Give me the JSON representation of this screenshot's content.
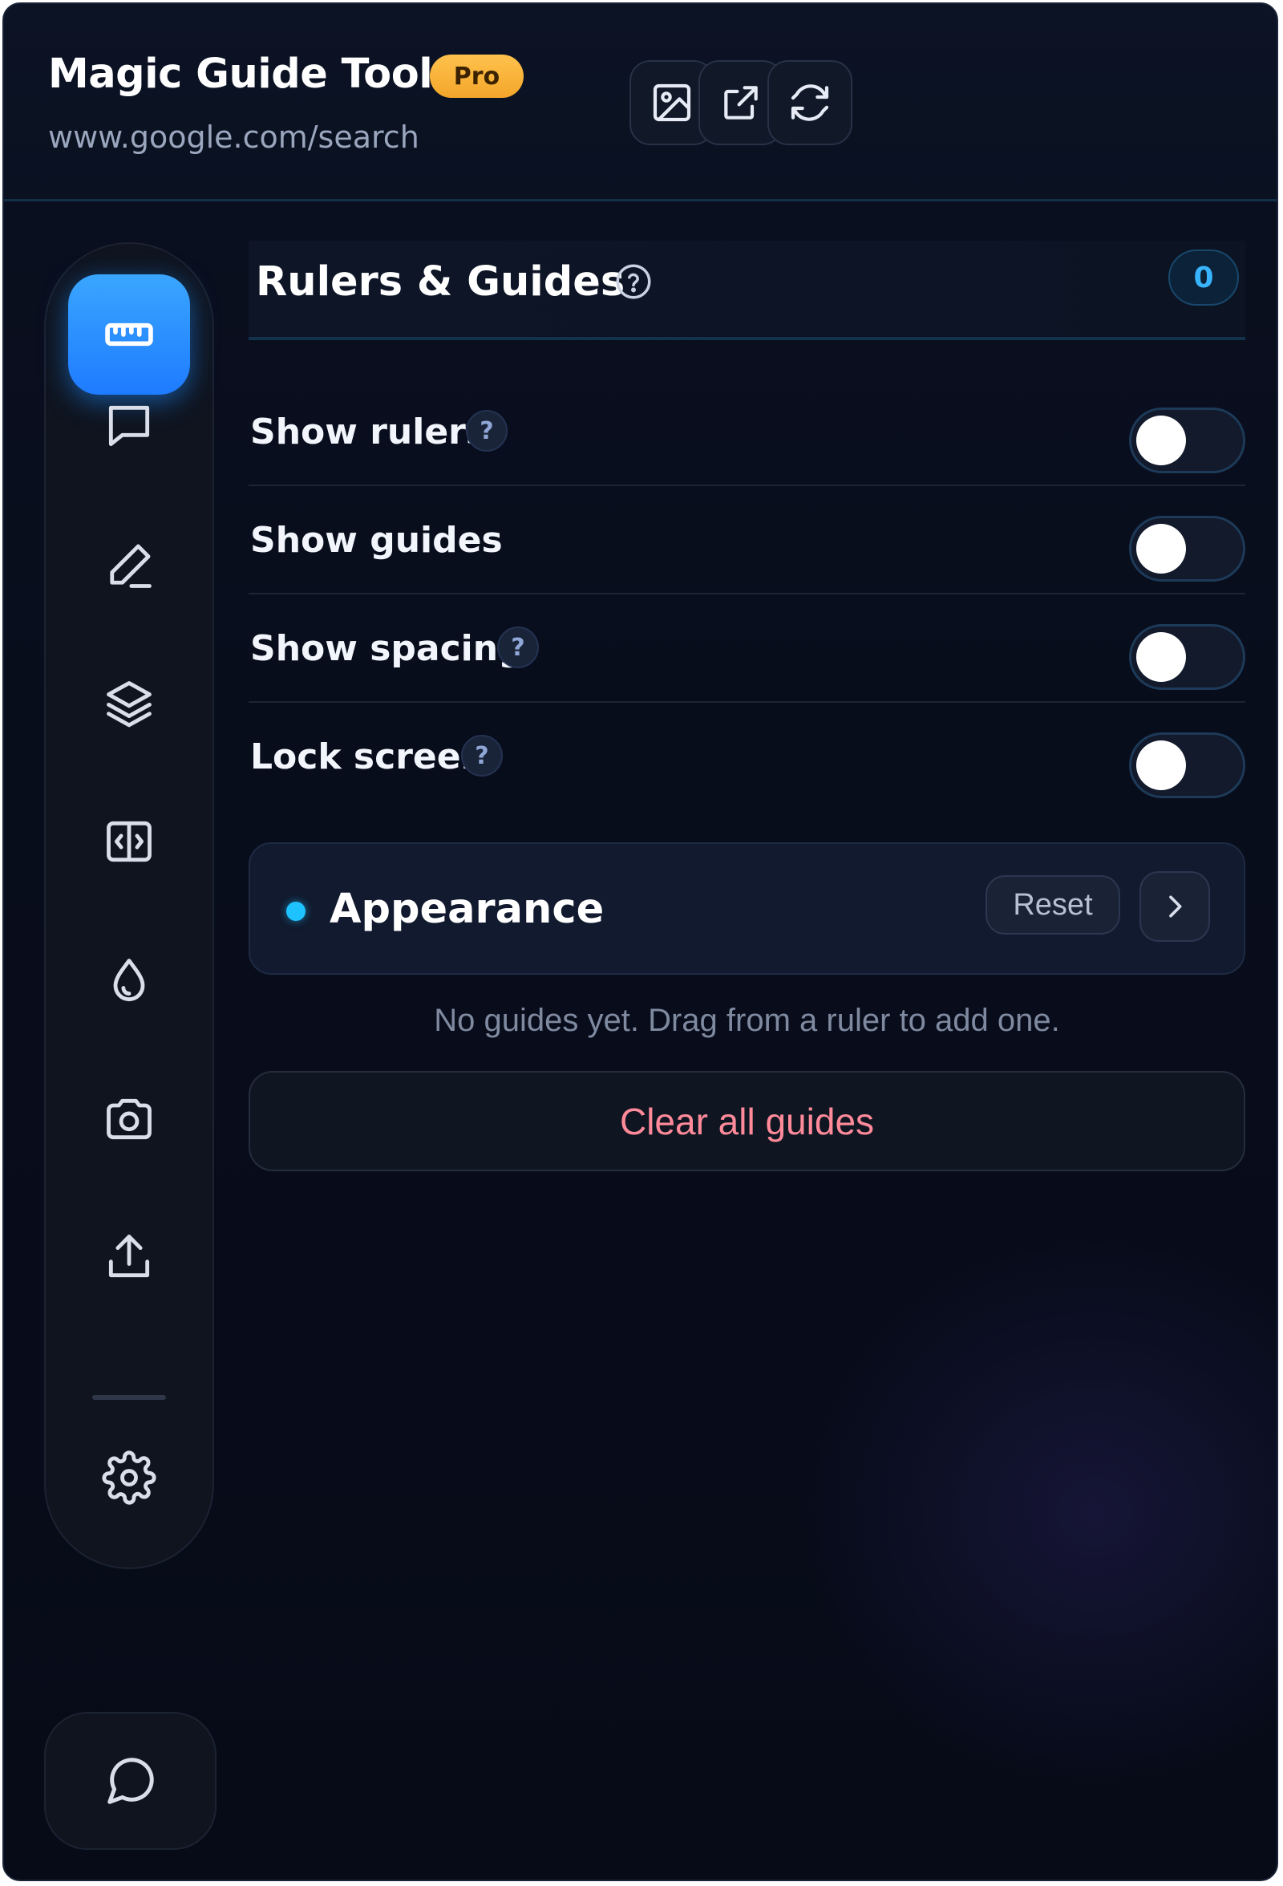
{
  "header": {
    "title": "Magic Guide Tool",
    "badge": "Pro",
    "url": "www.google.com/search",
    "buttons": [
      {
        "icon": "image-icon"
      },
      {
        "icon": "external-link-icon"
      },
      {
        "icon": "refresh-icon"
      }
    ]
  },
  "sidebar": {
    "items": [
      {
        "icon": "ruler-icon",
        "active": true
      },
      {
        "icon": "comment-icon"
      },
      {
        "icon": "pencil-icon"
      },
      {
        "icon": "layers-icon"
      },
      {
        "icon": "split-compare-icon"
      },
      {
        "icon": "droplet-icon"
      },
      {
        "icon": "camera-icon"
      },
      {
        "icon": "upload-icon"
      },
      {
        "icon": "gear-icon"
      }
    ],
    "chat_icon": "chat-bubble-icon"
  },
  "section": {
    "title": "Rulers & Guides",
    "count": "0"
  },
  "toggles": [
    {
      "label": "Show rulers",
      "help": "?",
      "on": false
    },
    {
      "label": "Show guides",
      "on": false
    },
    {
      "label": "Show spacing",
      "help": "?",
      "on": false
    },
    {
      "label": "Lock screen",
      "help": "?",
      "on": false
    }
  ],
  "appearance": {
    "label": "Appearance",
    "reset_label": "Reset"
  },
  "empty_message": "No guides yet. Drag from a ruler to add one.",
  "clear_label": "Clear all guides",
  "colors": {
    "accent": "#1e8bff",
    "badge": "#f6ae33",
    "count": "#38b4ff",
    "danger": "#ff8a9a",
    "dot": "#1ec2ff"
  }
}
